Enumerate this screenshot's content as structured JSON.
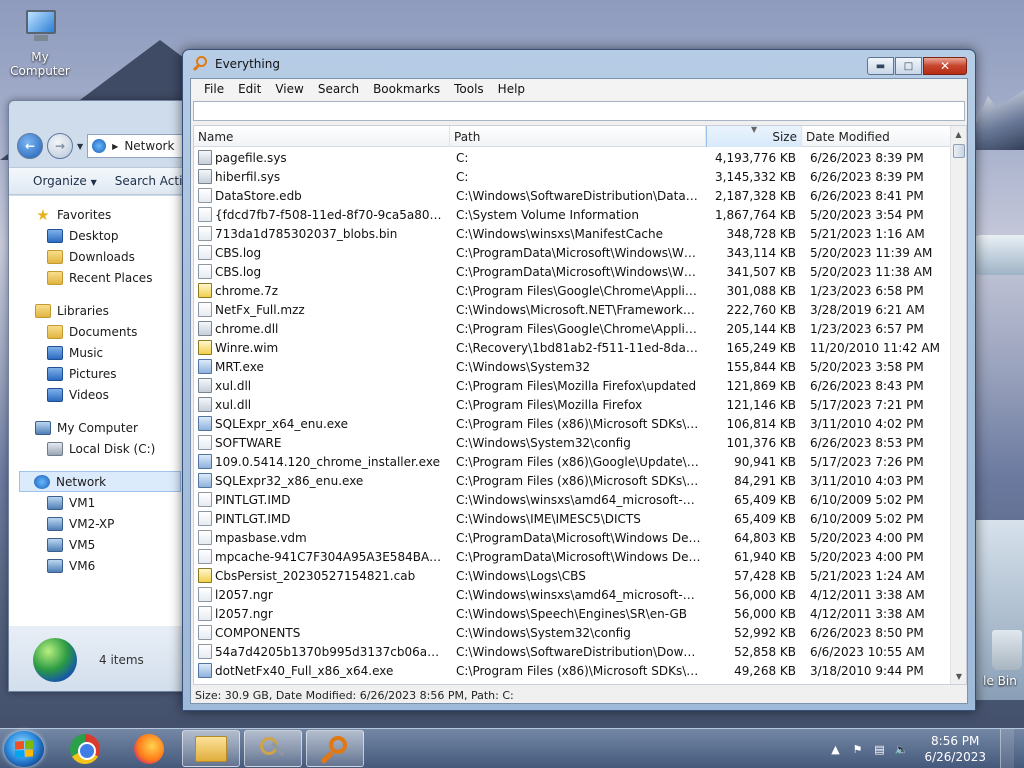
{
  "desktop": {
    "icons": [
      {
        "label": "My Computer"
      },
      {
        "label": "le Bin"
      }
    ]
  },
  "explorer": {
    "address": "Network",
    "toolbar": [
      "Organize",
      "Search Acti"
    ],
    "nav": {
      "favorites": {
        "label": "Favorites",
        "items": [
          "Desktop",
          "Downloads",
          "Recent Places"
        ]
      },
      "libraries": {
        "label": "Libraries",
        "items": [
          "Documents",
          "Music",
          "Pictures",
          "Videos"
        ]
      },
      "computer": {
        "label": "My Computer",
        "items": [
          "Local Disk (C:)"
        ]
      },
      "network": {
        "label": "Network",
        "items": [
          "VM1",
          "VM2-XP",
          "VM5",
          "VM6"
        ]
      }
    },
    "status": "4 items"
  },
  "everything": {
    "title": "Everything",
    "menu": [
      "File",
      "Edit",
      "View",
      "Search",
      "Bookmarks",
      "Tools",
      "Help"
    ],
    "search_value": "",
    "columns": {
      "name": "Name",
      "path": "Path",
      "size": "Size",
      "date": "Date Modified"
    },
    "rows": [
      {
        "name": "pagefile.sys",
        "path": "C:",
        "size": "4,193,776 KB",
        "date": "6/26/2023 8:39 PM",
        "icon": "sys"
      },
      {
        "name": "hiberfil.sys",
        "path": "C:",
        "size": "3,145,332 KB",
        "date": "6/26/2023 8:39 PM",
        "icon": "sys"
      },
      {
        "name": "DataStore.edb",
        "path": "C:\\Windows\\SoftwareDistribution\\DataStore",
        "size": "2,187,328 KB",
        "date": "6/26/2023 8:41 PM",
        "icon": "doc"
      },
      {
        "name": "{fdcd7fb7-f508-11ed-8f70-9ca5a8067355}{...",
        "path": "C:\\System Volume Information",
        "size": "1,867,764 KB",
        "date": "5/20/2023 3:54 PM",
        "icon": "doc"
      },
      {
        "name": "713da1d785302037_blobs.bin",
        "path": "C:\\Windows\\winsxs\\ManifestCache",
        "size": "348,728 KB",
        "date": "5/21/2023 1:16 AM",
        "icon": "doc"
      },
      {
        "name": "CBS.log",
        "path": "C:\\ProgramData\\Microsoft\\Windows\\WER\\R...",
        "size": "343,114 KB",
        "date": "5/20/2023 11:39 AM",
        "icon": "doc"
      },
      {
        "name": "CBS.log",
        "path": "C:\\ProgramData\\Microsoft\\Windows\\WER\\R...",
        "size": "341,507 KB",
        "date": "5/20/2023 11:38 AM",
        "icon": "doc"
      },
      {
        "name": "chrome.7z",
        "path": "C:\\Program Files\\Google\\Chrome\\Applicatio...",
        "size": "301,088 KB",
        "date": "1/23/2023 6:58 PM",
        "icon": "zip"
      },
      {
        "name": "NetFx_Full.mzz",
        "path": "C:\\Windows\\Microsoft.NET\\Framework64\\v4...",
        "size": "222,760 KB",
        "date": "3/28/2019 6:21 AM",
        "icon": "doc"
      },
      {
        "name": "chrome.dll",
        "path": "C:\\Program Files\\Google\\Chrome\\Applicatio...",
        "size": "205,144 KB",
        "date": "1/23/2023 6:57 PM",
        "icon": "sys"
      },
      {
        "name": "Winre.wim",
        "path": "C:\\Recovery\\1bd81ab2-f511-11ed-8da7-febaf...",
        "size": "165,249 KB",
        "date": "11/20/2010 11:42 AM",
        "icon": "zip"
      },
      {
        "name": "MRT.exe",
        "path": "C:\\Windows\\System32",
        "size": "155,844 KB",
        "date": "5/20/2023 3:58 PM",
        "icon": "exe"
      },
      {
        "name": "xul.dll",
        "path": "C:\\Program Files\\Mozilla Firefox\\updated",
        "size": "121,869 KB",
        "date": "6/26/2023 8:43 PM",
        "icon": "sys"
      },
      {
        "name": "xul.dll",
        "path": "C:\\Program Files\\Mozilla Firefox",
        "size": "121,146 KB",
        "date": "5/17/2023 7:21 PM",
        "icon": "sys"
      },
      {
        "name": "SQLExpr_x64_enu.exe",
        "path": "C:\\Program Files (x86)\\Microsoft SDKs\\Wind...",
        "size": "106,814 KB",
        "date": "3/11/2010 4:02 PM",
        "icon": "exe"
      },
      {
        "name": "SOFTWARE",
        "path": "C:\\Windows\\System32\\config",
        "size": "101,376 KB",
        "date": "6/26/2023 8:53 PM",
        "icon": "doc"
      },
      {
        "name": "109.0.5414.120_chrome_installer.exe",
        "path": "C:\\Program Files (x86)\\Google\\Update\\Down...",
        "size": "90,941 KB",
        "date": "5/17/2023 7:26 PM",
        "icon": "exe"
      },
      {
        "name": "SQLExpr32_x86_enu.exe",
        "path": "C:\\Program Files (x86)\\Microsoft SDKs\\Wind...",
        "size": "84,291 KB",
        "date": "3/11/2010 4:03 PM",
        "icon": "exe"
      },
      {
        "name": "PINTLGT.IMD",
        "path": "C:\\Windows\\winsxs\\amd64_microsoft-windo...",
        "size": "65,409 KB",
        "date": "6/10/2009 5:02 PM",
        "icon": "doc"
      },
      {
        "name": "PINTLGT.IMD",
        "path": "C:\\Windows\\IME\\IMESC5\\DICTS",
        "size": "65,409 KB",
        "date": "6/10/2009 5:02 PM",
        "icon": "doc"
      },
      {
        "name": "mpasbase.vdm",
        "path": "C:\\ProgramData\\Microsoft\\Windows Defend...",
        "size": "64,803 KB",
        "date": "5/20/2023 4:00 PM",
        "icon": "doc"
      },
      {
        "name": "mpcache-941C7F304A95A3E584BAF4E3A8...",
        "path": "C:\\ProgramData\\Microsoft\\Windows Defend...",
        "size": "61,940 KB",
        "date": "5/20/2023 4:00 PM",
        "icon": "doc"
      },
      {
        "name": "CbsPersist_20230527154821.cab",
        "path": "C:\\Windows\\Logs\\CBS",
        "size": "57,428 KB",
        "date": "5/21/2023 1:24 AM",
        "icon": "zip"
      },
      {
        "name": "l2057.ngr",
        "path": "C:\\Windows\\winsxs\\amd64_microsoft-windo...",
        "size": "56,000 KB",
        "date": "4/12/2011 3:38 AM",
        "icon": "doc"
      },
      {
        "name": "l2057.ngr",
        "path": "C:\\Windows\\Speech\\Engines\\SR\\en-GB",
        "size": "56,000 KB",
        "date": "4/12/2011 3:38 AM",
        "icon": "doc"
      },
      {
        "name": "COMPONENTS",
        "path": "C:\\Windows\\System32\\config",
        "size": "52,992 KB",
        "date": "6/26/2023 8:50 PM",
        "icon": "doc"
      },
      {
        "name": "54a7d4205b1370b995d3137cb06a4f097d17...",
        "path": "C:\\Windows\\SoftwareDistribution\\Download",
        "size": "52,858 KB",
        "date": "6/6/2023 10:55 AM",
        "icon": "doc"
      },
      {
        "name": "dotNetFx40_Full_x86_x64.exe",
        "path": "C:\\Program Files (x86)\\Microsoft SDKs\\Wind...",
        "size": "49,268 KB",
        "date": "3/18/2010 9:44 PM",
        "icon": "exe"
      }
    ],
    "status": "Size: 30.9 GB, Date Modified: 6/26/2023 8:56 PM, Path: C:"
  },
  "taskbar": {
    "clock_time": "8:56 PM",
    "clock_date": "6/26/2023"
  }
}
